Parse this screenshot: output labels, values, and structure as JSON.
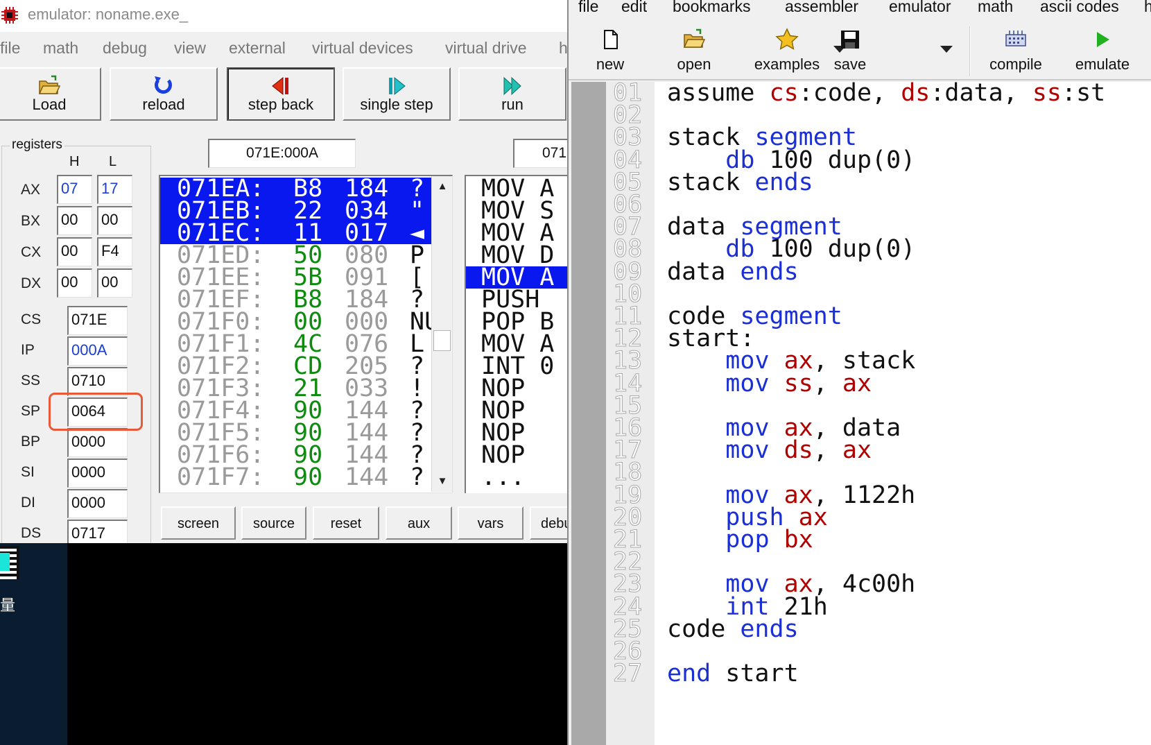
{
  "emulator": {
    "title": "emulator: noname.exe_",
    "menu": [
      "file",
      "math",
      "debug",
      "view",
      "external",
      "virtual devices",
      "virtual drive",
      "h"
    ],
    "toolbar": {
      "load": "Load",
      "reload": "reload",
      "step_back": "step back",
      "single_step": "single step",
      "run": "run"
    },
    "registers": {
      "legend": "registers",
      "h_header": "H",
      "l_header": "L",
      "split": [
        {
          "name": "AX",
          "h": "07",
          "l": "17"
        },
        {
          "name": "BX",
          "h": "00",
          "l": "00"
        },
        {
          "name": "CX",
          "h": "00",
          "l": "F4"
        },
        {
          "name": "DX",
          "h": "00",
          "l": "00"
        }
      ],
      "full": [
        {
          "name": "CS",
          "value": "071E"
        },
        {
          "name": "IP",
          "value": "000A"
        },
        {
          "name": "SS",
          "value": "0710"
        },
        {
          "name": "SP",
          "value": "0064"
        },
        {
          "name": "BP",
          "value": "0000"
        },
        {
          "name": "SI",
          "value": "0000"
        },
        {
          "name": "DI",
          "value": "0000"
        },
        {
          "name": "DS",
          "value": "0717"
        }
      ]
    },
    "address_box": "071E:000A",
    "address_box_2": "071",
    "memory": [
      {
        "addr": "071EA:",
        "hex": "B8",
        "dec": "184",
        "chr": "?",
        "selected": true
      },
      {
        "addr": "071EB:",
        "hex": "22",
        "dec": "034",
        "chr": "\"",
        "selected": true
      },
      {
        "addr": "071EC:",
        "hex": "11",
        "dec": "017",
        "chr": "◄",
        "selected": true
      },
      {
        "addr": "071ED:",
        "hex": "50",
        "dec": "080",
        "chr": "P",
        "selected": false
      },
      {
        "addr": "071EE:",
        "hex": "5B",
        "dec": "091",
        "chr": "[",
        "selected": false
      },
      {
        "addr": "071EF:",
        "hex": "B8",
        "dec": "184",
        "chr": "?",
        "selected": false
      },
      {
        "addr": "071F0:",
        "hex": "00",
        "dec": "000",
        "chr": "NU",
        "selected": false
      },
      {
        "addr": "071F1:",
        "hex": "4C",
        "dec": "076",
        "chr": "L",
        "selected": false
      },
      {
        "addr": "071F2:",
        "hex": "CD",
        "dec": "205",
        "chr": "?",
        "selected": false
      },
      {
        "addr": "071F3:",
        "hex": "21",
        "dec": "033",
        "chr": "!",
        "selected": false
      },
      {
        "addr": "071F4:",
        "hex": "90",
        "dec": "144",
        "chr": "?",
        "selected": false
      },
      {
        "addr": "071F5:",
        "hex": "90",
        "dec": "144",
        "chr": "?",
        "selected": false
      },
      {
        "addr": "071F6:",
        "hex": "90",
        "dec": "144",
        "chr": "?",
        "selected": false
      },
      {
        "addr": "071F7:",
        "hex": "90",
        "dec": "144",
        "chr": "?",
        "selected": false
      }
    ],
    "disassembly": [
      {
        "text": "MOV A",
        "selected": false
      },
      {
        "text": "MOV S",
        "selected": false
      },
      {
        "text": "MOV A",
        "selected": false
      },
      {
        "text": "MOV D",
        "selected": false
      },
      {
        "text": "MOV A",
        "selected": true
      },
      {
        "text": "PUSH",
        "selected": false
      },
      {
        "text": "POP B",
        "selected": false
      },
      {
        "text": "MOV A",
        "selected": false
      },
      {
        "text": "INT 0",
        "selected": false
      },
      {
        "text": "NOP",
        "selected": false
      },
      {
        "text": "NOP",
        "selected": false
      },
      {
        "text": "NOP",
        "selected": false
      },
      {
        "text": "NOP",
        "selected": false
      },
      {
        "text": "...",
        "selected": false
      }
    ],
    "bottom_buttons": [
      "screen",
      "source",
      "reset",
      "aux",
      "vars",
      "debu"
    ]
  },
  "desktop": {
    "icon_label": "量"
  },
  "editor": {
    "menu": [
      "file",
      "edit",
      "bookmarks",
      "assembler",
      "emulator",
      "math",
      "ascii codes",
      "h"
    ],
    "toolbar": {
      "new": "new",
      "open": "open",
      "examples": "examples",
      "save": "save",
      "compile": "compile",
      "emulate": "emulate"
    },
    "line_numbers": [
      "01",
      "02",
      "03",
      "04",
      "05",
      "06",
      "07",
      "08",
      "09",
      "10",
      "11",
      "12",
      "13",
      "14",
      "15",
      "16",
      "17",
      "18",
      "19",
      "20",
      "21",
      "22",
      "23",
      "24",
      "25",
      "26",
      "27"
    ],
    "code": [
      [
        [
          "id",
          "assume "
        ],
        [
          "reg",
          "cs"
        ],
        [
          "id",
          ":code, "
        ],
        [
          "reg",
          "ds"
        ],
        [
          "id",
          ":data, "
        ],
        [
          "reg",
          "ss"
        ],
        [
          "id",
          ":st"
        ]
      ],
      [],
      [
        [
          "id",
          "stack "
        ],
        [
          "kw",
          "segment"
        ]
      ],
      [
        [
          "id",
          "    "
        ],
        [
          "kw",
          "db"
        ],
        [
          "id",
          " 100 dup(0)"
        ]
      ],
      [
        [
          "id",
          "stack "
        ],
        [
          "kw",
          "ends"
        ]
      ],
      [],
      [
        [
          "id",
          "data "
        ],
        [
          "kw",
          "segment"
        ]
      ],
      [
        [
          "id",
          "    "
        ],
        [
          "kw",
          "db"
        ],
        [
          "id",
          " 100 dup(0)"
        ]
      ],
      [
        [
          "id",
          "data "
        ],
        [
          "kw",
          "ends"
        ]
      ],
      [],
      [
        [
          "id",
          "code "
        ],
        [
          "kw",
          "segment"
        ]
      ],
      [
        [
          "id",
          "start:"
        ]
      ],
      [
        [
          "id",
          "    "
        ],
        [
          "kw",
          "mov"
        ],
        [
          "id",
          " "
        ],
        [
          "reg",
          "ax"
        ],
        [
          "id",
          ", stack"
        ]
      ],
      [
        [
          "id",
          "    "
        ],
        [
          "kw",
          "mov"
        ],
        [
          "id",
          " "
        ],
        [
          "reg",
          "ss"
        ],
        [
          "id",
          ", "
        ],
        [
          "reg",
          "ax"
        ]
      ],
      [],
      [
        [
          "id",
          "    "
        ],
        [
          "kw",
          "mov"
        ],
        [
          "id",
          " "
        ],
        [
          "reg",
          "ax"
        ],
        [
          "id",
          ", data"
        ]
      ],
      [
        [
          "id",
          "    "
        ],
        [
          "kw",
          "mov"
        ],
        [
          "id",
          " "
        ],
        [
          "reg",
          "ds"
        ],
        [
          "id",
          ", "
        ],
        [
          "reg",
          "ax"
        ]
      ],
      [],
      [
        [
          "id",
          "    "
        ],
        [
          "kw",
          "mov"
        ],
        [
          "id",
          " "
        ],
        [
          "reg",
          "ax"
        ],
        [
          "id",
          ", 1122h"
        ]
      ],
      [
        [
          "id",
          "    "
        ],
        [
          "kw",
          "push"
        ],
        [
          "id",
          " "
        ],
        [
          "reg",
          "ax"
        ]
      ],
      [
        [
          "id",
          "    "
        ],
        [
          "kw",
          "pop"
        ],
        [
          "id",
          " "
        ],
        [
          "reg",
          "bx"
        ]
      ],
      [],
      [
        [
          "id",
          "    "
        ],
        [
          "kw",
          "mov"
        ],
        [
          "id",
          " "
        ],
        [
          "reg",
          "ax"
        ],
        [
          "id",
          ", 4c00h"
        ]
      ],
      [
        [
          "id",
          "    "
        ],
        [
          "kw",
          "int"
        ],
        [
          "id",
          " 21h"
        ]
      ],
      [
        [
          "id",
          "code "
        ],
        [
          "kw",
          "ends"
        ]
      ],
      [],
      [
        [
          "kw",
          "end"
        ],
        [
          "id",
          " start"
        ]
      ]
    ]
  },
  "colors": {
    "selection": "#0a18f0",
    "keyword": "#1b2fd6",
    "register": "#b00000",
    "hex_value": "#0e8a0e",
    "sp_highlight": "#e8593a"
  }
}
